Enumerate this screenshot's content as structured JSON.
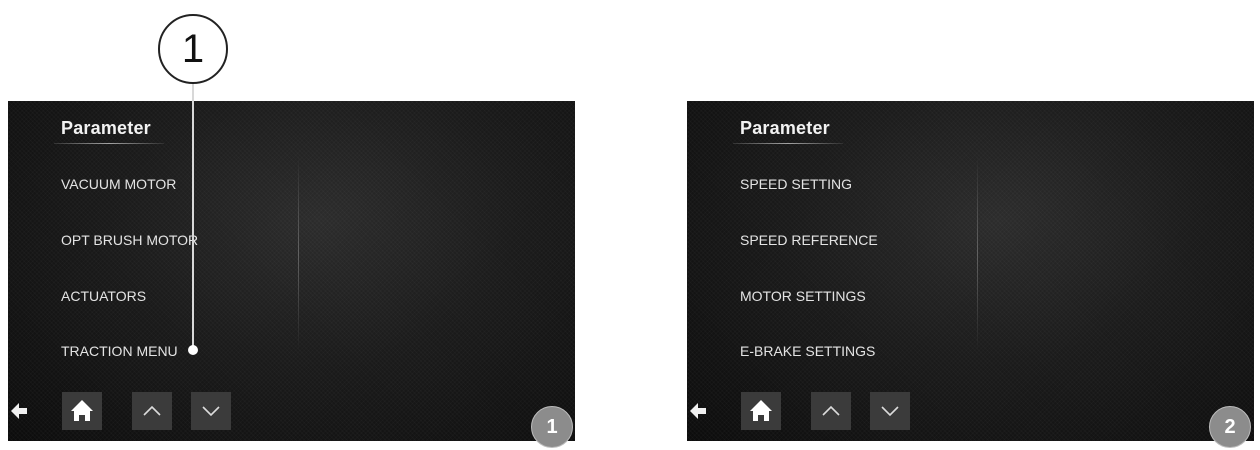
{
  "screens": [
    {
      "title": "Parameter",
      "menu_items": [
        "VACUUM MOTOR",
        "OPT BRUSH MOTOR",
        "ACTUATORS",
        "TRACTION MENU"
      ],
      "page_number": "1"
    },
    {
      "title": "Parameter",
      "menu_items": [
        "SPEED SETTING",
        "SPEED REFERENCE",
        "MOTOR SETTINGS",
        "E-BRAKE SETTINGS"
      ],
      "page_number": "2"
    }
  ],
  "nav_buttons": [
    "back-arrow-icon",
    "home-icon",
    "chevron-up-icon",
    "chevron-down-icon"
  ],
  "callout": {
    "number": "1",
    "target": "TRACTION MENU"
  },
  "colors": {
    "screen_background": "#1b1b1b",
    "button_background": "#3b3b3b",
    "menu_text": "#e4e4e4",
    "badge": "#8c8c8c"
  }
}
